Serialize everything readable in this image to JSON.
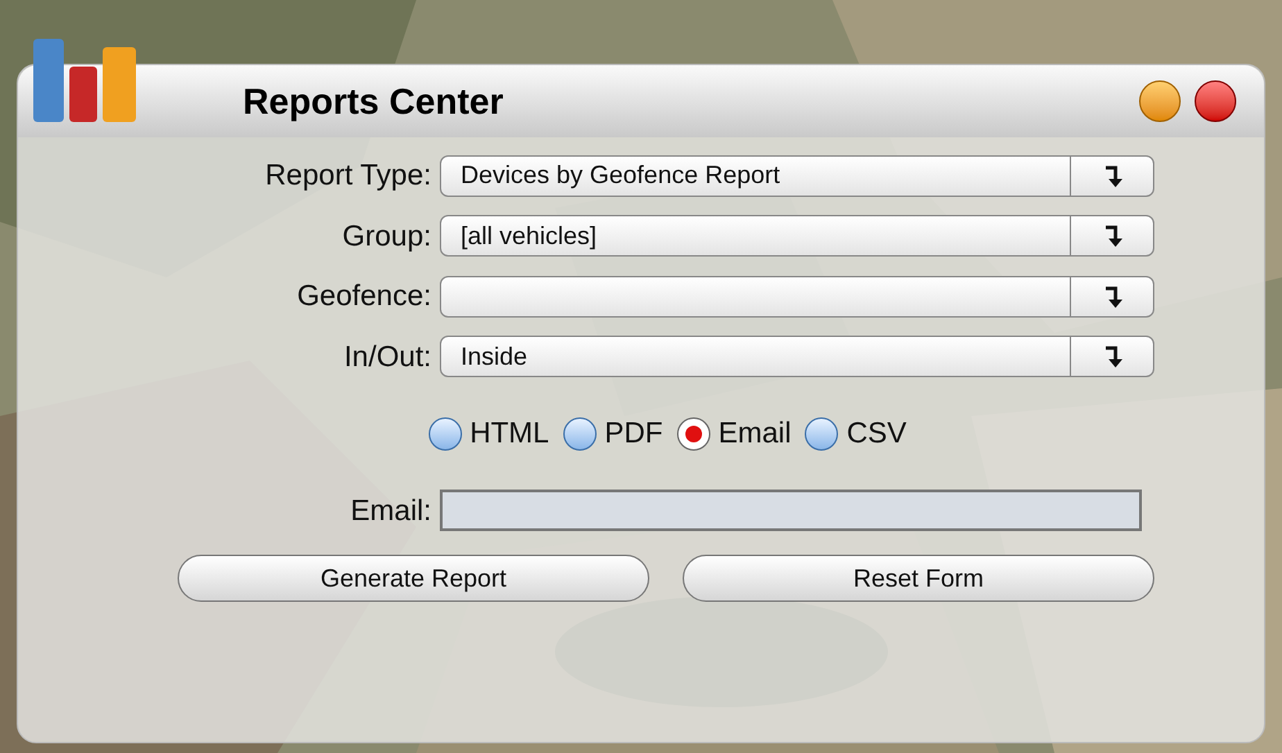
{
  "window": {
    "title": "Reports Center"
  },
  "fields": [
    {
      "label": "Report Type:",
      "value": "Devices by Geofence Report"
    },
    {
      "label": "Group:",
      "value": "[all vehicles]"
    },
    {
      "label": "Geofence:"
    },
    {
      "label": "In/Out:",
      "value": "Inside"
    }
  ],
  "formats": [
    {
      "label": "HTML",
      "selected": false
    },
    {
      "label": "PDF",
      "selected": false
    },
    {
      "label": "Email",
      "selected": true
    },
    {
      "label": "CSV",
      "selected": false
    }
  ],
  "email": {
    "label": "Email:"
  },
  "buttons": [
    "Generate Report",
    "Reset Form"
  ]
}
